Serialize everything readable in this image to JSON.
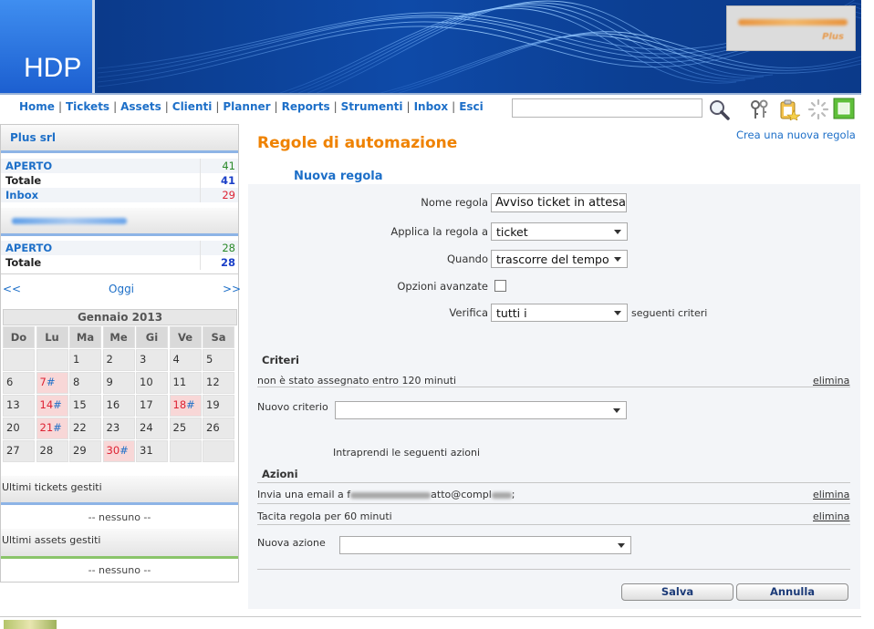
{
  "header": {
    "logo_text": "HDP",
    "brand_tag": "Plus"
  },
  "nav": {
    "links": [
      "Home",
      "Tickets",
      "Assets",
      "Clienti",
      "Planner",
      "Reports",
      "Strumenti",
      "Inbox",
      "Esci"
    ],
    "search_value": "",
    "icons": [
      "search-icon",
      "keys-icon",
      "clipboard-icon",
      "spinner-icon",
      "green-square-icon"
    ]
  },
  "sidebar": {
    "company": "Plus srl",
    "stats1": [
      {
        "label": "APERTO",
        "value": "41",
        "color": "#2a8a2a"
      },
      {
        "label": "Totale",
        "value": "41",
        "color": "#1a3fc8"
      },
      {
        "label": "Inbox",
        "value": "29",
        "color": "#d23"
      }
    ],
    "stats2": [
      {
        "label": "APERTO",
        "value": "28",
        "color": "#2a8a2a"
      },
      {
        "label": "Totale",
        "value": "28",
        "color": "#1a3fc8"
      }
    ],
    "cal_prev": "<<",
    "cal_today": "Oggi",
    "cal_next": ">>",
    "cal_month": "Gennaio 2013",
    "cal_days": [
      "Do",
      "Lu",
      "Ma",
      "Me",
      "Gi",
      "Ve",
      "Sa"
    ],
    "last_tickets_title": "Ultimi tickets gestiti",
    "last_tickets_empty": "-- nessuno --",
    "last_assets_title": "Ultimi assets gestiti",
    "last_assets_empty": "-- nessuno --"
  },
  "main": {
    "title": "Regole di automazione",
    "create_link": "Crea una nuova regola",
    "subtitle": "Nuova regola",
    "form": {
      "name_label": "Nome regola",
      "name_value": "Avviso ticket in attesa",
      "apply_label": "Applica la regola a",
      "apply_value": "ticket",
      "when_label": "Quando",
      "when_value": "trascorre del tempo",
      "advanced_label": "Opzioni avanzate",
      "verify_label": "Verifica",
      "verify_value": "tutti i",
      "verify_suffix": "seguenti criteri"
    },
    "criteria": {
      "title": "Criteri",
      "row": "non è stato assegnato entro 120 minuti",
      "delete": "elimina",
      "new_label": "Nuovo criterio",
      "new_value": ""
    },
    "actions_intro": "Intraprendi le seguenti azioni",
    "actions": {
      "title": "Azioni",
      "row1_prefix": "Invia una email a f",
      "row1_mid": "atto@compl",
      "row1_suffix": ";",
      "row2": "Tacita regola per 60 minuti",
      "delete": "elimina",
      "new_label": "Nuova azione",
      "new_value": ""
    },
    "buttons": {
      "save": "Salva",
      "cancel": "Annulla"
    }
  }
}
